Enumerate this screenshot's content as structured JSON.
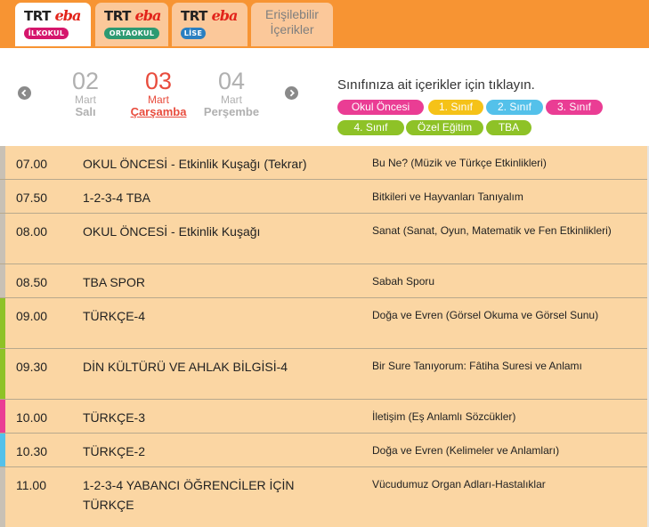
{
  "tabs": [
    {
      "logo_trt": "TRT",
      "logo_eba": "eba",
      "badge": "İLKOKUL",
      "badge_color": "#d5166c",
      "active": true
    },
    {
      "logo_trt": "TRT",
      "logo_eba": "eba",
      "badge": "ORTAOKUL",
      "badge_color": "#2d9a72",
      "active": false
    },
    {
      "logo_trt": "TRT",
      "logo_eba": "eba",
      "badge": "LİSE",
      "badge_color": "#2a7fc1",
      "active": false
    },
    {
      "line1": "Erişilebilir",
      "line2": "İçerikler",
      "active": false
    }
  ],
  "dates": [
    {
      "num": "02",
      "month": "Mart",
      "day": "Salı",
      "active": false
    },
    {
      "num": "03",
      "month": "Mart",
      "day": "Çarşamba",
      "active": true
    },
    {
      "num": "04",
      "month": "Mart",
      "day": "Perşembe",
      "active": false
    }
  ],
  "nav": {
    "prev_icon": "chevron-left-icon",
    "next_icon": "chevron-right-icon"
  },
  "class_filter": {
    "prompt": "Sınıfınıza ait içerikler için tıklayın.",
    "chips": [
      {
        "label": "Okul Öncesi",
        "color": "#ea3d94"
      },
      {
        "label": "1. Sınıf",
        "color": "#f5c218"
      },
      {
        "label": "2. Sınıf",
        "color": "#54c1ea"
      },
      {
        "label": "3. Sınıf",
        "color": "#ea3d94"
      },
      {
        "label": "4. Sınıf",
        "color": "#8ec227"
      },
      {
        "label": "Özel Eğitim",
        "color": "#8ec227"
      },
      {
        "label": "TBA",
        "color": "#8ec227"
      }
    ]
  },
  "schedule": [
    {
      "time": "07.00",
      "course": "OKUL ÖNCESİ - Etkinlik Kuşağı (Tekrar)",
      "topic": "Bu Ne? (Müzik ve Türkçe Etkinlikleri)",
      "stripe": "#c9c1b5"
    },
    {
      "time": "07.50",
      "course": "1-2-3-4 TBA",
      "topic": "Bitkileri ve Hayvanları Tanıyalım",
      "stripe": "#c9c1b5"
    },
    {
      "time": "08.00",
      "course": "OKUL ÖNCESİ - Etkinlik Kuşağı",
      "topic": "Sanat (Sanat, Oyun, Matematik ve Fen Etkinlikleri)",
      "stripe": "#c9c1b5"
    },
    {
      "time": "08.50",
      "course": "TBA SPOR",
      "topic": "Sabah Sporu",
      "stripe": "#c9c1b5"
    },
    {
      "time": "09.00",
      "course": "TÜRKÇE-4",
      "topic": "Doğa ve Evren (Görsel Okuma ve Görsel Sunu)",
      "stripe": "#8ec227"
    },
    {
      "time": "09.30",
      "course": "DİN KÜLTÜRÜ VE AHLAK BİLGİSİ-4",
      "topic": "Bir Sure Tanıyorum: Fâtiha Suresi ve Anlamı",
      "stripe": "#8ec227"
    },
    {
      "time": "10.00",
      "course": "TÜRKÇE-3",
      "topic": "İletişim (Eş Anlamlı Sözcükler)",
      "stripe": "#ea3d94"
    },
    {
      "time": "10.30",
      "course": "TÜRKÇE-2",
      "topic": "Doğa ve Evren (Kelimeler ve Anlamları)",
      "stripe": "#54c1ea"
    },
    {
      "time": "11.00",
      "course": "1-2-3-4 YABANCI ÖĞRENCİLER İÇİN TÜRKÇE",
      "topic": "Vücudumuz Organ Adları-Hastalıklar",
      "stripe": "#c9c1b5"
    }
  ]
}
